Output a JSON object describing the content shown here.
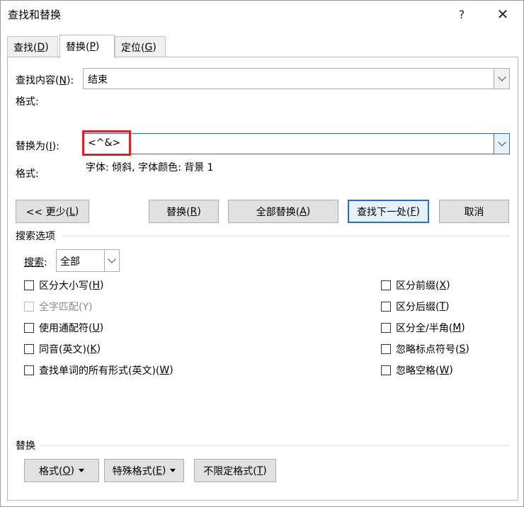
{
  "window": {
    "title": "查找和替换",
    "help_glyph": "?",
    "close_glyph": "✕"
  },
  "tabs": [
    {
      "label": "查找(",
      "key": "D",
      "suffix": ")"
    },
    {
      "label": "替换(",
      "key": "P",
      "suffix": ")"
    },
    {
      "label": "定位(",
      "key": "G",
      "suffix": ")"
    }
  ],
  "find": {
    "label": "查找内容(",
    "key": "N",
    "suffix": "):",
    "value": "结束",
    "format_label": "格式:"
  },
  "replace": {
    "label": "替换为(",
    "key": "I",
    "suffix": "):",
    "value": "<^&>",
    "format_label": "格式:",
    "format_value": "字体: 倾斜, 字体颜色: 背景 1"
  },
  "buttons": {
    "less": {
      "label": "<< 更少(",
      "key": "L",
      "suffix": ")"
    },
    "replace": {
      "label": "替换(",
      "key": "R",
      "suffix": ")"
    },
    "replace_all": {
      "label": "全部替换(",
      "key": "A",
      "suffix": ")"
    },
    "find_next": {
      "label": "查找下一处(",
      "key": "F",
      "suffix": ")"
    },
    "cancel": {
      "label": "取消"
    }
  },
  "search_options": {
    "title": "搜索选项",
    "search_label": "搜索",
    "search_colon": ":",
    "search_value": "全部",
    "left": [
      {
        "label": "区分大小写(",
        "key": "H",
        "suffix": ")",
        "checked": false,
        "disabled": false
      },
      {
        "label": "全字匹配(Y)",
        "key": "",
        "suffix": "",
        "checked": false,
        "disabled": true
      },
      {
        "label": "使用通配符(",
        "key": "U",
        "suffix": ")",
        "checked": false,
        "disabled": false
      },
      {
        "label": "同音(英文)(",
        "key": "K",
        "suffix": ")",
        "checked": false,
        "disabled": false
      },
      {
        "label": "查找单词的所有形式(英文)(",
        "key": "W",
        "suffix": ")",
        "checked": false,
        "disabled": false
      }
    ],
    "right": [
      {
        "label": "区分前缀(",
        "key": "X",
        "suffix": ")",
        "checked": false
      },
      {
        "label": "区分后缀(",
        "key": "T",
        "suffix": ")",
        "checked": false
      },
      {
        "label": "区分全/半角(",
        "key": "M",
        "suffix": ")",
        "checked": false
      },
      {
        "label": "忽略标点符号(",
        "key": "S",
        "suffix": ")",
        "checked": false
      },
      {
        "label": "忽略空格(",
        "key": "W",
        "suffix": ")",
        "checked": false
      }
    ]
  },
  "replace_section": {
    "title": "替换",
    "format": {
      "label": "格式(",
      "key": "O",
      "suffix": ")"
    },
    "special": {
      "label": "特殊格式(",
      "key": "E",
      "suffix": ")"
    },
    "no_format": {
      "label": "不限定格式(",
      "key": "T",
      "suffix": ")"
    }
  }
}
